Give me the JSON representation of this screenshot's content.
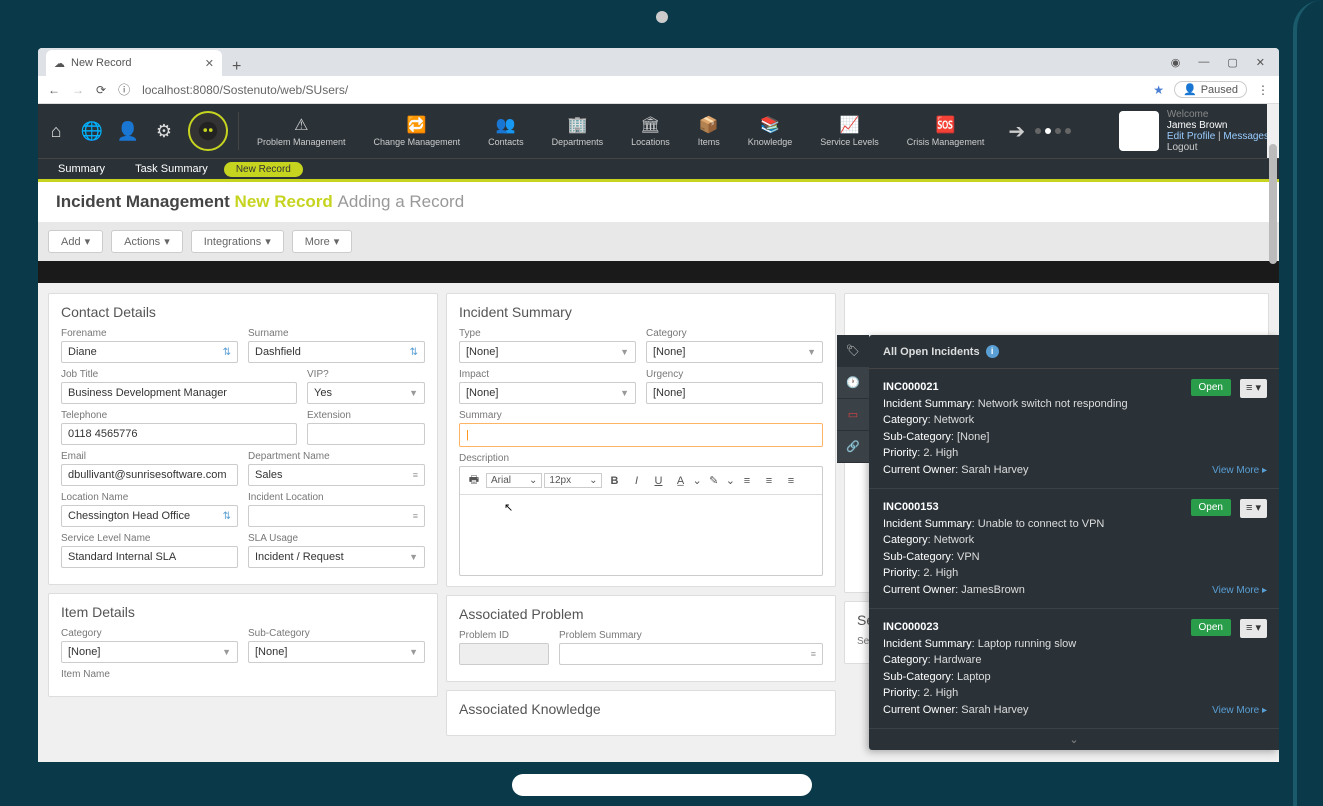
{
  "browser": {
    "tab_title": "New Record",
    "url": "localhost:8080/Sostenuto/web/SUsers/",
    "paused": "Paused"
  },
  "nav": {
    "modules": [
      "Problem Management",
      "Change Management",
      "Contacts",
      "Departments",
      "Locations",
      "Items",
      "Knowledge",
      "Service Levels",
      "Crisis Management"
    ],
    "user_welcome": "Welcome",
    "user_name": "James Brown",
    "edit_profile": "Edit Profile",
    "messages": "Messages",
    "logout": "Logout"
  },
  "subnav": {
    "summary": "Summary",
    "task": "Task Summary",
    "new": "New Record"
  },
  "crumb": {
    "a": "Incident Management",
    "b": "New Record",
    "c": "Adding a Record"
  },
  "actions": {
    "add": "Add",
    "actions": "Actions",
    "integrations": "Integrations",
    "more": "More"
  },
  "contact": {
    "title": "Contact Details",
    "forename_l": "Forename",
    "forename": "Diane",
    "surname_l": "Surname",
    "surname": "Dashfield",
    "job_l": "Job Title",
    "job": "Business Development Manager",
    "vip_l": "VIP?",
    "vip": "Yes",
    "tel_l": "Telephone",
    "tel": "0118 4565776",
    "ext_l": "Extension",
    "ext": "",
    "email_l": "Email",
    "email": "dbullivant@sunrisesoftware.com",
    "dept_l": "Department Name",
    "dept": "Sales",
    "loc_l": "Location Name",
    "loc": "Chessington Head Office",
    "iloc_l": "Incident Location",
    "iloc": "",
    "sla_l": "Service Level Name",
    "sla": "Standard Internal SLA",
    "slau_l": "SLA Usage",
    "slau": "Incident / Request"
  },
  "item": {
    "title": "Item Details",
    "cat_l": "Category",
    "cat": "[None]",
    "sub_l": "Sub-Category",
    "sub": "[None]",
    "name_l": "Item Name"
  },
  "incsum": {
    "title": "Incident Summary",
    "type_l": "Type",
    "type": "[None]",
    "cat_l": "Category",
    "cat": "[None]",
    "imp_l": "Impact",
    "imp": "[None]",
    "urg_l": "Urgency",
    "urg": "[None]",
    "sum_l": "Summary",
    "desc_l": "Description",
    "font": "Arial",
    "size": "12px"
  },
  "assoc_p": {
    "title": "Associated Problem",
    "pid_l": "Problem ID",
    "psum_l": "Problem Summary"
  },
  "assoc_k": {
    "title": "Associated Knowledge"
  },
  "svc": {
    "title": "Servic",
    "svc_l": "Service"
  },
  "side": {
    "title": "All Open Incidents",
    "open": "Open",
    "view_more": "View More ▸",
    "items": [
      {
        "id": "INC000021",
        "sum": "Network switch not responding",
        "cat": "Network",
        "sub": "[None]",
        "pri": "2. High",
        "own": "Sarah Harvey"
      },
      {
        "id": "INC000153",
        "sum": "Unable to connect to VPN",
        "cat": "Network",
        "sub": "VPN",
        "pri": "2. High",
        "own": "JamesBrown"
      },
      {
        "id": "INC000023",
        "sum": "Laptop running slow",
        "cat": "Hardware",
        "sub": "Laptop",
        "pri": "2. High",
        "own": "Sarah Harvey"
      }
    ]
  }
}
